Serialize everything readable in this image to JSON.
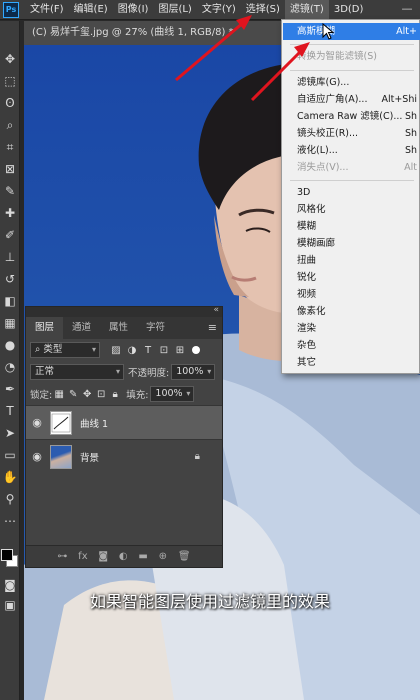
{
  "menubar": {
    "items": [
      "文件(F)",
      "编辑(E)",
      "图像(I)",
      "图层(L)",
      "文字(Y)",
      "选择(S)",
      "滤镜(T)",
      "3D(D)"
    ],
    "logo": "Ps"
  },
  "document": {
    "tab_title": "(C) 易烊千玺.jpg @ 27% (曲线 1, RGB/8) *"
  },
  "filter_menu": {
    "items": [
      {
        "label": "高斯模糊",
        "shortcut": "Alt+"
      },
      {
        "label": "转换为智能滤镜(S)",
        "shortcut": ""
      },
      {
        "label": "滤镜库(G)...",
        "shortcut": ""
      },
      {
        "label": "自适应广角(A)...",
        "shortcut": "Alt+Shi"
      },
      {
        "label": "Camera Raw 滤镜(C)...",
        "shortcut": "Sh"
      },
      {
        "label": "镜头校正(R)...",
        "shortcut": "Sh"
      },
      {
        "label": "液化(L)...",
        "shortcut": "Sh"
      },
      {
        "label": "消失点(V)...",
        "shortcut": "Alt"
      },
      {
        "label": "3D",
        "shortcut": ""
      },
      {
        "label": "风格化",
        "shortcut": ""
      },
      {
        "label": "模糊",
        "shortcut": ""
      },
      {
        "label": "模糊画廊",
        "shortcut": ""
      },
      {
        "label": "扭曲",
        "shortcut": ""
      },
      {
        "label": "锐化",
        "shortcut": ""
      },
      {
        "label": "视频",
        "shortcut": ""
      },
      {
        "label": "像素化",
        "shortcut": ""
      },
      {
        "label": "渲染",
        "shortcut": ""
      },
      {
        "label": "杂色",
        "shortcut": ""
      },
      {
        "label": "其它",
        "shortcut": ""
      }
    ]
  },
  "layers_panel": {
    "tabs": [
      "图层",
      "通道",
      "属性",
      "字符"
    ],
    "filter_kind": "类型",
    "blend_mode": "正常",
    "opacity_label": "不透明度:",
    "opacity_value": "100%",
    "lock_label": "锁定:",
    "fill_label": "填充:",
    "fill_value": "100%",
    "layers": [
      {
        "name": "曲线 1",
        "selected": true
      },
      {
        "name": "背景",
        "selected": false
      }
    ]
  },
  "subtitle": "如果智能图层使用过滤镜里的效果",
  "colors": {
    "accent": "#2f7ee6",
    "arrow": "#e0141e",
    "canvas_blue": "#1d4aa0"
  }
}
